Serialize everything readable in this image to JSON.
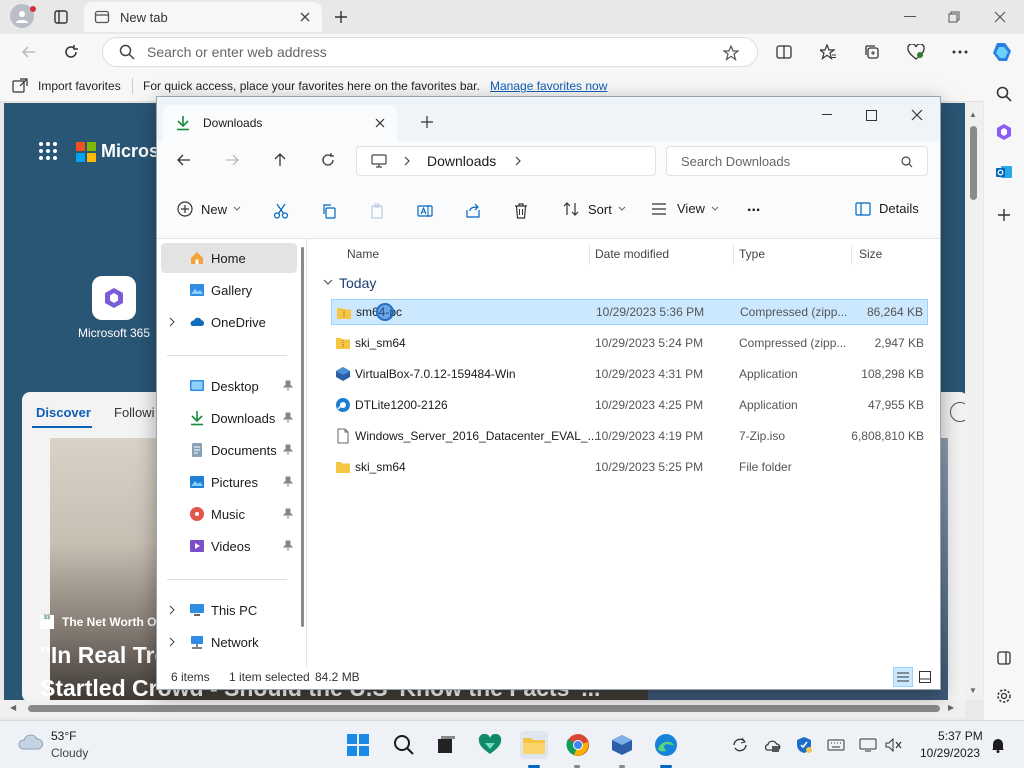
{
  "browser": {
    "tab_title": "New tab",
    "address_placeholder": "Search or enter web address",
    "favbar": {
      "import_label": "Import favorites",
      "info_text": "For quick access, place your favorites here on the favorites bar.",
      "manage_link": "Manage favorites now"
    }
  },
  "ntp": {
    "brand": "Microsoft",
    "app_label": "Microsoft 365",
    "tabs": [
      "Discover",
      "Followi"
    ],
    "news_source": "The Net Worth Of",
    "headline_line1": "\"In Real Tro",
    "headline_line2": "Startled Crowd - Should the U.S 'Know the Facts' ..."
  },
  "explorer": {
    "tab_title": "Downloads",
    "address": "Downloads",
    "search_placeholder": "Search Downloads",
    "commands": {
      "new": "New",
      "sort": "Sort",
      "view": "View",
      "details": "Details",
      "more": "..."
    },
    "nav": [
      {
        "label": "Home",
        "icon": "home-icon",
        "selected": true
      },
      {
        "label": "Gallery",
        "icon": "gallery-icon"
      },
      {
        "label": "OneDrive",
        "icon": "onedrive-icon"
      },
      {
        "label": "Desktop",
        "icon": "desktop-icon",
        "pinned": true
      },
      {
        "label": "Downloads",
        "icon": "download-icon",
        "pinned": true
      },
      {
        "label": "Documents",
        "icon": "documents-icon",
        "pinned": true
      },
      {
        "label": "Pictures",
        "icon": "pictures-icon",
        "pinned": true
      },
      {
        "label": "Music",
        "icon": "music-icon",
        "pinned": true
      },
      {
        "label": "Videos",
        "icon": "videos-icon",
        "pinned": true
      },
      {
        "label": "This PC",
        "icon": "pc-icon"
      },
      {
        "label": "Network",
        "icon": "network-icon"
      }
    ],
    "columns": {
      "name": "Name",
      "date": "Date modified",
      "type": "Type",
      "size": "Size"
    },
    "group": "Today",
    "files": [
      {
        "name": "sm64-pc",
        "date": "10/29/2023 5:36 PM",
        "type": "Compressed (zipp...",
        "size": "86,264 KB",
        "icon": "zip-icon",
        "selected": true
      },
      {
        "name": "ski_sm64",
        "date": "10/29/2023 5:24 PM",
        "type": "Compressed (zipp...",
        "size": "2,947 KB",
        "icon": "zip-icon"
      },
      {
        "name": "VirtualBox-7.0.12-159484-Win",
        "date": "10/29/2023 4:31 PM",
        "type": "Application",
        "size": "108,298 KB",
        "icon": "virtualbox-icon"
      },
      {
        "name": "DTLite1200-2126",
        "date": "10/29/2023 4:25 PM",
        "type": "Application",
        "size": "47,955 KB",
        "icon": "daemon-tools-icon"
      },
      {
        "name": "Windows_Server_2016_Datacenter_EVAL_...",
        "date": "10/29/2023 4:19 PM",
        "type": "7-Zip.iso",
        "size": "6,808,810 KB",
        "icon": "file-icon"
      },
      {
        "name": "ski_sm64",
        "date": "10/29/2023 5:25 PM",
        "type": "File folder",
        "size": "",
        "icon": "folder-icon"
      }
    ],
    "status": {
      "count": "6 items",
      "selected": "1 item selected",
      "size": "84.2 MB"
    }
  },
  "taskbar": {
    "weather_temp": "53°F",
    "weather_desc": "Cloudy",
    "time": "5:37 PM",
    "date": "10/29/2023"
  },
  "colors": {
    "accent": "#0067c0",
    "selection": "#cce8ff",
    "link": "#0f5fb8"
  }
}
